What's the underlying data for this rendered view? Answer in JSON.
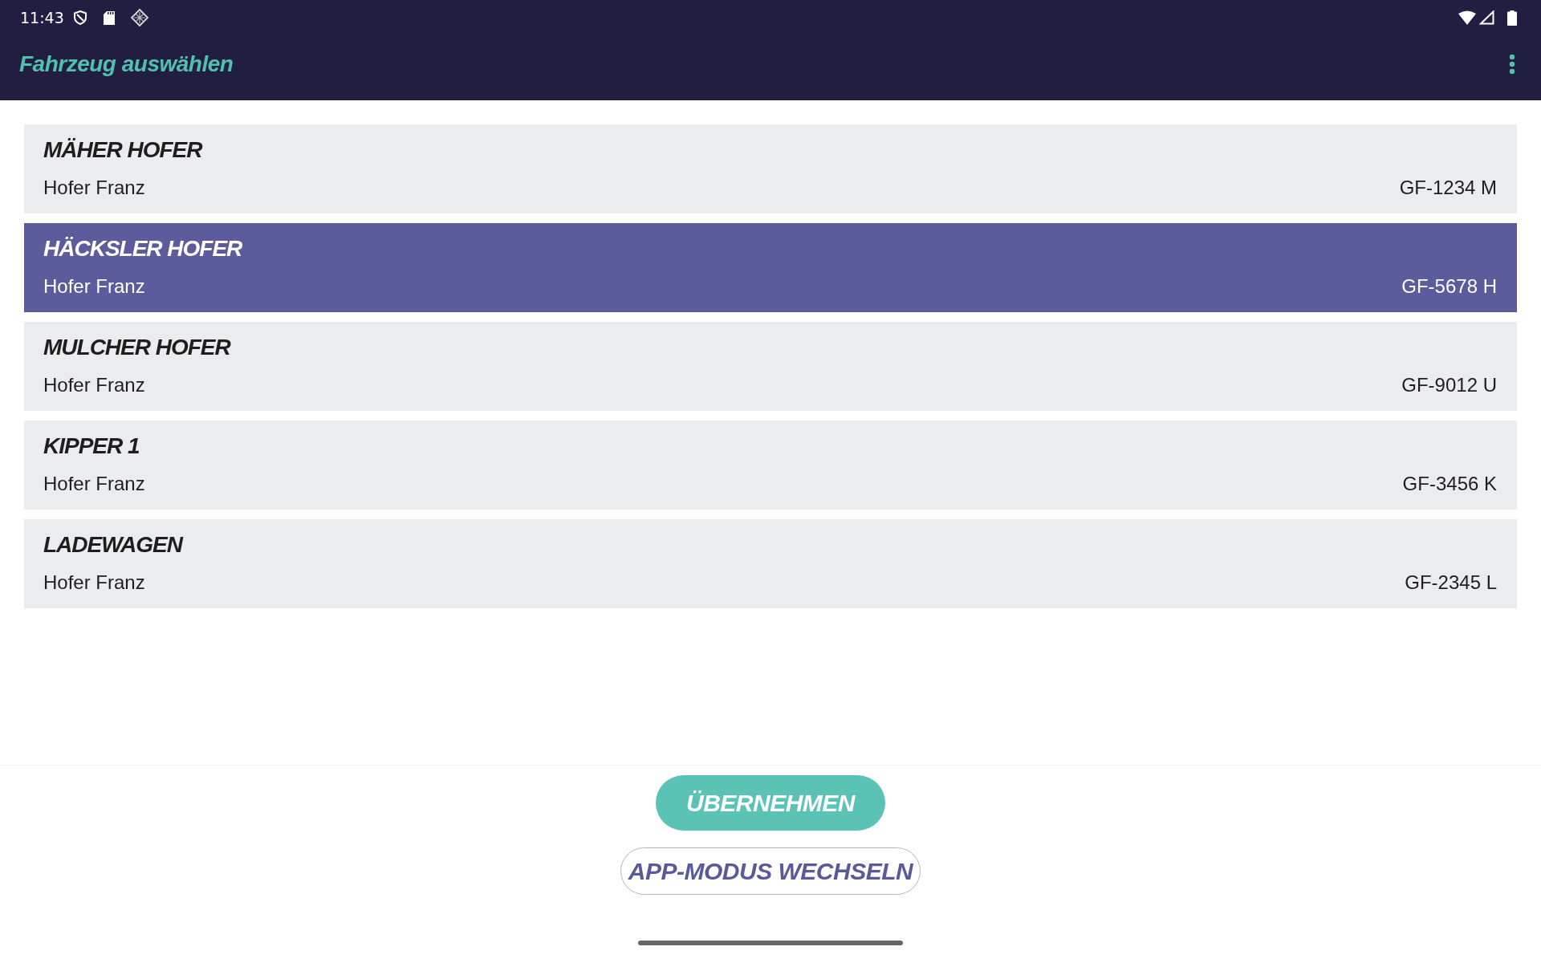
{
  "status_bar": {
    "time": "11:43"
  },
  "app_bar": {
    "title": "Fahrzeug auswählen"
  },
  "vehicles": [
    {
      "name": "MÄHER HOFER",
      "owner": "Hofer Franz",
      "plate": "GF-1234 M",
      "selected": false
    },
    {
      "name": "HÄCKSLER HOFER",
      "owner": "Hofer Franz",
      "plate": "GF-5678 H",
      "selected": true
    },
    {
      "name": "MULCHER HOFER",
      "owner": "Hofer Franz",
      "plate": "GF-9012 U",
      "selected": false
    },
    {
      "name": "KIPPER 1",
      "owner": "Hofer Franz",
      "plate": "GF-3456 K",
      "selected": false
    },
    {
      "name": "LADEWAGEN",
      "owner": "Hofer Franz",
      "plate": "GF-2345 L",
      "selected": false
    }
  ],
  "buttons": [
    {
      "label": "ÜBERNEHMEN",
      "kind": "primary"
    },
    {
      "label": "APP-MODUS WECHSELN",
      "kind": "outlined"
    }
  ]
}
